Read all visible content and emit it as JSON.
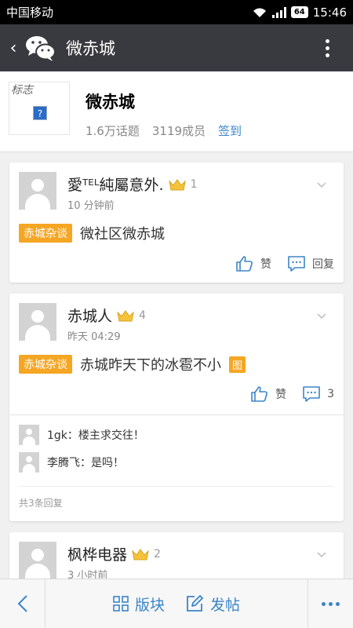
{
  "status_bar": {
    "carrier": "中国移动",
    "battery": "64",
    "time": "15:46"
  },
  "title_bar": {
    "title": "微赤城"
  },
  "community": {
    "logo_alt": "标志",
    "logo_placeholder": "?",
    "name": "微赤城",
    "topics": "1.6万话题",
    "members": "3119成员",
    "signin": "签到"
  },
  "posts": [
    {
      "author": "愛ᵀᴱᴸ純屬意外.",
      "level": "1",
      "time": "10 分钟前",
      "tag": "赤城杂谈",
      "text": "微社区微赤城",
      "like_label": "赞",
      "reply_label": "回复"
    },
    {
      "author": "赤城人",
      "level": "4",
      "time": "昨天 04:29",
      "tag": "赤城杂谈",
      "text": "赤城昨天下的冰雹不小",
      "pic_badge": "图",
      "like_label": "赞",
      "reply_count": "3",
      "replies": [
        {
          "text": "1gk：楼主求交往！"
        },
        {
          "text": "李腾飞：是吗！"
        }
      ],
      "reply_total": "共3条回复"
    },
    {
      "author": "枫桦电器",
      "level": "2",
      "time": "3 小时前"
    }
  ],
  "bottom_bar": {
    "board_label": "版块",
    "post_label": "发帖"
  },
  "colors": {
    "accent": "#3a85c8",
    "tag": "#f5a623",
    "titlebar": "#393a3f"
  }
}
